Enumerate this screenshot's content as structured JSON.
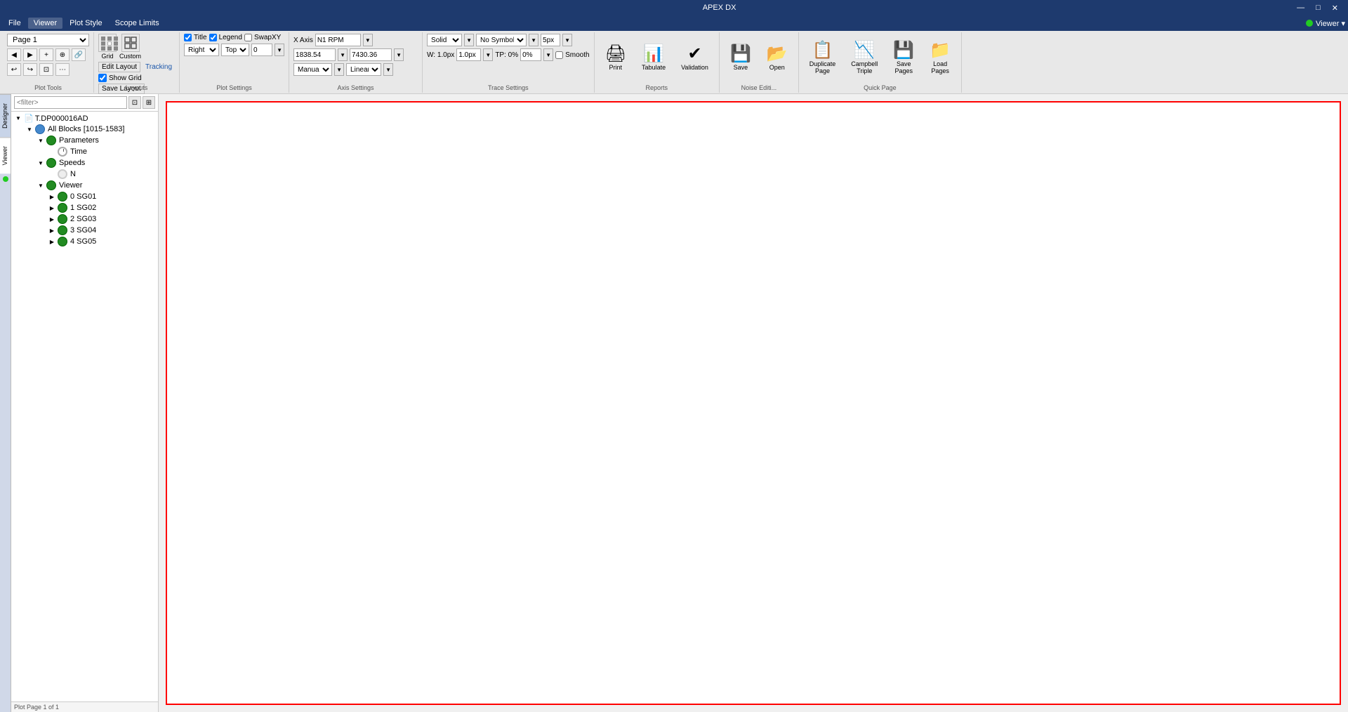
{
  "titleBar": {
    "title": "APEX DX",
    "minimizeLabel": "—",
    "maximizeLabel": "□",
    "closeLabel": "✕"
  },
  "menuBar": {
    "items": [
      "File",
      "Viewer",
      "Plot Style",
      "Scope Limits"
    ],
    "activeItem": "Viewer",
    "viewerBadge": "Viewer ▾"
  },
  "ribbon": {
    "pageGroup": {
      "pageOptions": [
        "Page 1"
      ],
      "selectedPage": "Page 1",
      "plotLabel": "Plot Page 1 of 1"
    },
    "plotToolsLabel": "Plot Tools",
    "layoutsLabel": "Layouts",
    "plotSettingsLabel": "Plot Settings",
    "axisSettingsLabel": "Axis Settings",
    "traceSettingsLabel": "Trace Settings",
    "reportsLabel": "Reports",
    "noiseEditLabel": "Noise Editi...",
    "quickPageLabel": "Quick Page",
    "buttons": {
      "grid": "Grid",
      "custom": "Custom",
      "editLayout": "Edit Layout",
      "showGrid": "Show Grid",
      "saveLayout": "Save Layout",
      "tracking": "Tracking",
      "title": "Title",
      "legend": "Legend",
      "swapXY": "SwapXY",
      "xAxis": "X Axis",
      "n1rpm": "N1 RPM",
      "yAxisLeft": "1838.54",
      "yAxisRight": "7430.36",
      "lineStyle": "Solid",
      "noSymbol": "No Symbol",
      "lineWidth": "5px",
      "wLabel": "W: 1.0px",
      "tpLabel": "TP: 0%",
      "smooth": "Smooth",
      "right": "Right",
      "top": "Top",
      "zeroVal": "0",
      "manual": "Manual",
      "linear": "Linear",
      "print": "Print",
      "tabulate": "Tabulate",
      "validation": "Validation",
      "save": "Save",
      "open": "Open",
      "duplicatePage": "Duplicate\nPage",
      "campbellTriple": "Campbell\nTriple",
      "savePages": "Save\nPages",
      "loadPages": "Load\nPages"
    }
  },
  "sidebar": {
    "tabs": [
      "Designer",
      "Viewer"
    ],
    "activeTab": "Viewer"
  },
  "tree": {
    "searchPlaceholder": "<filter>",
    "items": [
      {
        "id": "root",
        "label": "T.DP000016AD",
        "indent": 0,
        "type": "file",
        "expanded": true
      },
      {
        "id": "allblocks",
        "label": "All Blocks [1015-1583]",
        "indent": 1,
        "type": "circle-blue",
        "expanded": true
      },
      {
        "id": "parameters",
        "label": "Parameters",
        "indent": 2,
        "type": "circle-green",
        "expanded": true
      },
      {
        "id": "time",
        "label": "Time",
        "indent": 3,
        "type": "clock"
      },
      {
        "id": "speeds",
        "label": "Speeds",
        "indent": 2,
        "type": "circle-green",
        "expanded": true
      },
      {
        "id": "n",
        "label": "N",
        "indent": 3,
        "type": "clock-gray"
      },
      {
        "id": "viewer",
        "label": "Viewer",
        "indent": 2,
        "type": "circle-green",
        "expanded": true
      },
      {
        "id": "sg01",
        "label": "0 SG01",
        "indent": 3,
        "type": "circle-green",
        "hasChevron": true
      },
      {
        "id": "sg02",
        "label": "1 SG02",
        "indent": 3,
        "type": "circle-green",
        "hasChevron": true
      },
      {
        "id": "sg03",
        "label": "2 SG03",
        "indent": 3,
        "type": "circle-green",
        "hasChevron": true
      },
      {
        "id": "sg04",
        "label": "3 SG04",
        "indent": 3,
        "type": "circle-green",
        "hasChevron": true
      },
      {
        "id": "sg05",
        "label": "4 SG05",
        "indent": 3,
        "type": "circle-green",
        "hasChevron": true
      }
    ],
    "bottomLabel": "Plot Page 1 of 1"
  },
  "plot": {
    "borderColor": "#ff0000"
  }
}
